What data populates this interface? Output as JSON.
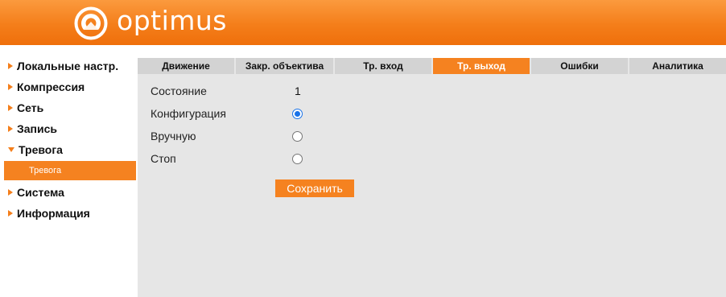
{
  "header": {
    "logo_text": "optimus",
    "brand_color": "#f47e1a"
  },
  "sidebar": {
    "items": [
      {
        "label": "Локальные настр.",
        "icon": "triangle-right-icon",
        "expanded": false
      },
      {
        "label": "Компрессия",
        "icon": "triangle-right-icon",
        "expanded": false
      },
      {
        "label": "Сеть",
        "icon": "triangle-right-icon",
        "expanded": false
      },
      {
        "label": "Запись",
        "icon": "triangle-right-icon",
        "expanded": false
      },
      {
        "label": "Тревога",
        "icon": "triangle-down-icon",
        "expanded": true
      },
      {
        "label": "Система",
        "icon": "triangle-right-icon",
        "expanded": false
      },
      {
        "label": "Информация",
        "icon": "triangle-right-icon",
        "expanded": false
      }
    ],
    "subitems": [
      {
        "label": "Тревога",
        "selected": true
      }
    ]
  },
  "tabs": [
    {
      "label": "Движение",
      "active": false
    },
    {
      "label": "Закр. объектива",
      "active": false
    },
    {
      "label": "Тр. вход",
      "active": false
    },
    {
      "label": "Тр. выход",
      "active": true
    },
    {
      "label": "Ошибки",
      "active": false
    },
    {
      "label": "Аналитика",
      "active": false
    }
  ],
  "form": {
    "state_label": "Состояние",
    "state_value": "1",
    "config_label": "Конфигурация",
    "manual_label": "Вручную",
    "stop_label": "Стоп",
    "selected_option": "Конфигурация",
    "save_label": "Сохранить"
  },
  "colors": {
    "accent": "#f58220",
    "tab_inactive": "#d3d3d3",
    "panel_background": "#e6e6e6",
    "radio_checked": "#1a73e8"
  }
}
